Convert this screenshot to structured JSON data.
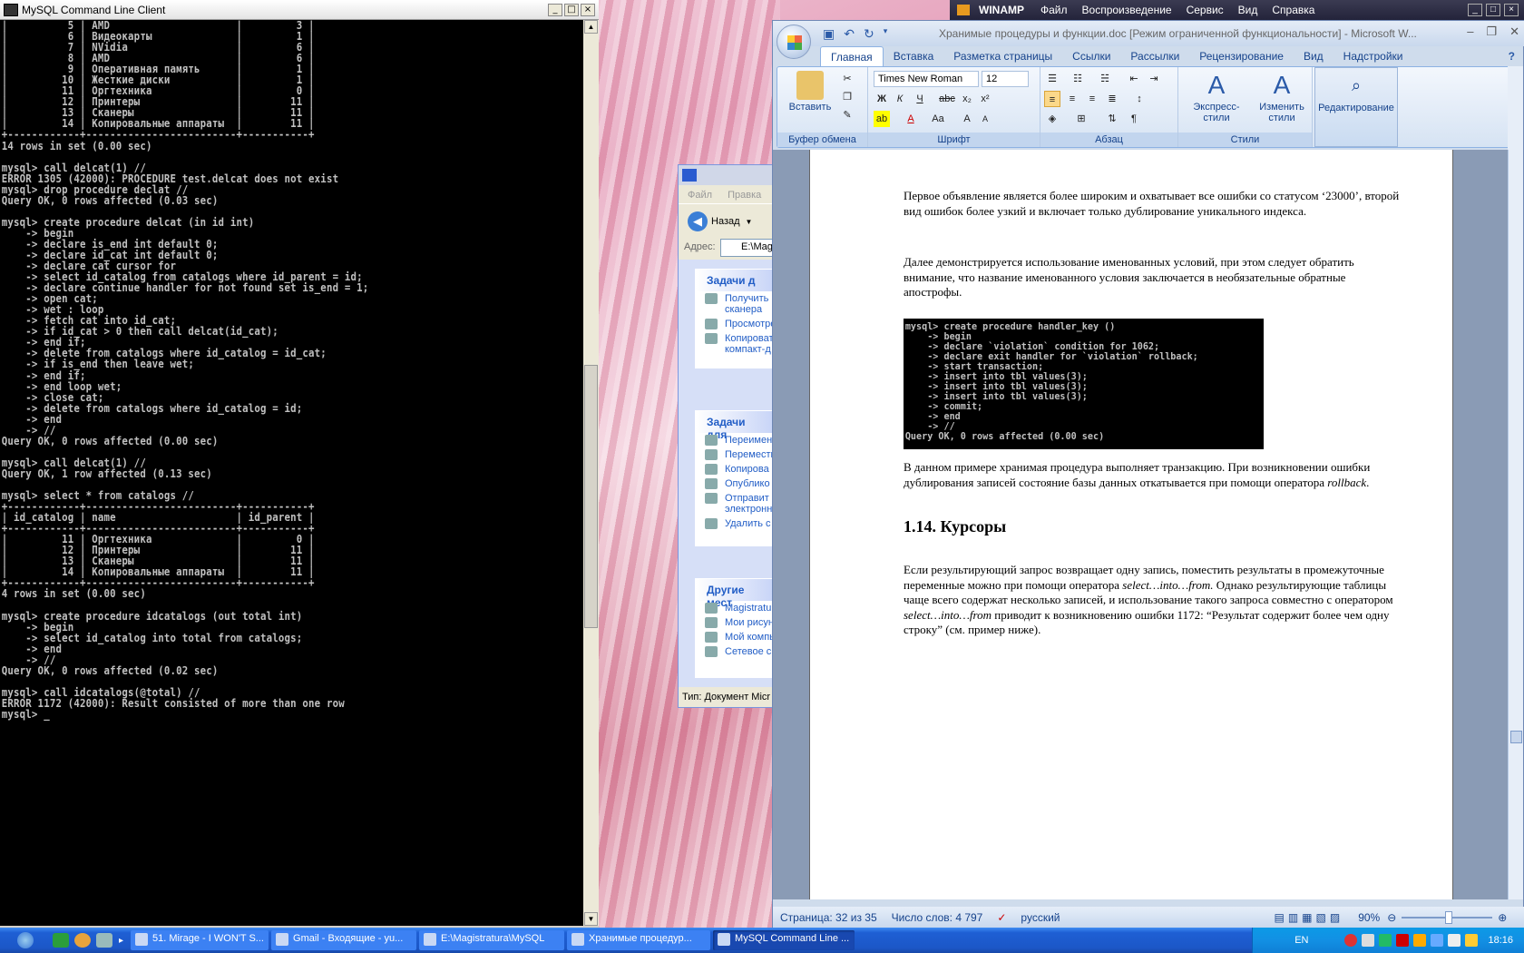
{
  "console": {
    "title": "MySQL Command Line Client",
    "text": "|          5 | AMD                     |         3 |\n|          6 | Видеокарты              |         1 |\n|          7 | NVidia                  |         6 |\n|          8 | AMD                     |         6 |\n|          9 | Оперативная память      |         1 |\n|         10 | Жесткие диски           |         1 |\n|         11 | Оргтехника              |         0 |\n|         12 | Принтеры                |        11 |\n|         13 | Сканеры                 |        11 |\n|         14 | Копировальные аппараты  |        11 |\n+------------+-------------------------+-----------+\n14 rows in set (0.00 sec)\n\nmysql> call delcat(1) //\nERROR 1305 (42000): PROCEDURE test.delcat does not exist\nmysql> drop procedure declat //\nQuery OK, 0 rows affected (0.03 sec)\n\nmysql> create procedure delcat (in id int)\n    -> begin\n    -> declare is_end int default 0;\n    -> declare id_cat int default 0;\n    -> declare cat cursor for\n    -> select id_catalog from catalogs where id_parent = id;\n    -> declare continue handler for not found set is_end = 1;\n    -> open cat;\n    -> wet : loop\n    -> fetch cat into id_cat;\n    -> if id_cat > 0 then call delcat(id_cat);\n    -> end if;\n    -> delete from catalogs where id_catalog = id_cat;\n    -> if is_end then leave wet;\n    -> end if;\n    -> end loop wet;\n    -> close cat;\n    -> delete from catalogs where id_catalog = id;\n    -> end\n    -> //\nQuery OK, 0 rows affected (0.00 sec)\n\nmysql> call delcat(1) //\nQuery OK, 1 row affected (0.13 sec)\n\nmysql> select * from catalogs //\n+------------+-------------------------+-----------+\n| id_catalog | name                    | id_parent |\n+------------+-------------------------+-----------+\n|         11 | Оргтехника              |         0 |\n|         12 | Принтеры                |        11 |\n|         13 | Сканеры                 |        11 |\n|         14 | Копировальные аппараты  |        11 |\n+------------+-------------------------+-----------+\n4 rows in set (0.00 sec)\n\nmysql> create procedure idcatalogs (out total int)\n    -> begin\n    -> select id_catalog into total from catalogs;\n    -> end\n    -> //\nQuery OK, 0 rows affected (0.02 sec)\n\nmysql> call idcatalogs(@total) //\nERROR 1172 (42000): Result consisted of more than one row\nmysql> _"
  },
  "explorer": {
    "menu": "Файл Правка",
    "back": "Назад",
    "address_label": "Адрес:",
    "address": "E:\\Magi",
    "panel1_title": "Задачи д",
    "panel1_items": [
      "Получить сканера",
      "Просмотре",
      "Копироват компакт-д"
    ],
    "panel2_title": "Задачи для",
    "panel2_items": [
      "Переимен",
      "Перемести",
      "Копирова",
      "Опублико",
      "Отправит электронн",
      "Удалить с"
    ],
    "panel3_title": "Другие мест",
    "panel3_items": [
      "Magistratu",
      "Мои рисун",
      "Мой компь",
      "Сетевое с"
    ],
    "status": "Тип: Документ Micr"
  },
  "winamp": {
    "name": "WINAMP",
    "menu": [
      "Файл",
      "Воспроизведение",
      "Сервис",
      "Вид",
      "Справка"
    ]
  },
  "word": {
    "title": "Хранимые процедуры и функции.doc [Режим ограниченной функциональности] - Microsoft W...",
    "tabs": [
      "Главная",
      "Вставка",
      "Разметка страницы",
      "Ссылки",
      "Рассылки",
      "Рецензирование",
      "Вид",
      "Надстройки"
    ],
    "ribbon": {
      "paste": "Вставить",
      "clipboard": "Буфер обмена",
      "font_name": "Times New Roman",
      "font_size": "12",
      "font": "Шрифт",
      "paragraph": "Абзац",
      "styles": "Стили",
      "express_styles": "Экспресс-стили",
      "change_styles": "Изменить стили",
      "editing": "Редактирование"
    },
    "doc": {
      "p1": "Первое объявление является более широким и охватывает все ошибки со статусом ‘23000’, второй вид ошибок более узкий и включает только дублирование уникального индекса.",
      "p2": "Далее демонстрируется использование именованных условий, при этом следует обратить внимание, что название именованного условия заключается в необязательные обратные апострофы.",
      "code": "mysql> create procedure handler_key ()\n    -> begin\n    -> declare `violation` condition for 1062;\n    -> declare exit handler for `violation` rollback;\n    -> start transaction;\n    -> insert into tbl values(3);\n    -> insert into tbl values(3);\n    -> insert into tbl values(3);\n    -> commit;\n    -> end\n    -> //\nQuery OK, 0 rows affected (0.00 sec)",
      "p3a": "В данном примере хранимая процедура выполняет транзакцию. При возникновении ошибки дублирования записей состояние базы данных откатывается при помощи оператора ",
      "p3b": "rollback",
      "p3c": ".",
      "heading": "1.14. Курсоры",
      "p4a": "Если результирующий запрос возвращает одну запись, поместить результаты в промежуточные переменные можно при помощи оператора ",
      "p4b": "select…into…from.",
      "p4c": "  Однако результирующие таблицы чаще всего содержат несколько записей, и использование такого запроса совместно с оператором ",
      "p4d": "select…into…from",
      "p4e": "  приводит к возникновению ошибки 1172: “Результат содержит более чем одну строку” (см. пример ниже)."
    },
    "status": {
      "page": "Страница: 32 из 35",
      "words": "Число слов: 4 797",
      "lang": "русский",
      "zoom": "90%"
    }
  },
  "taskbar": {
    "tasks": [
      "51. Mirage - I WON'T S...",
      "Gmail - Входящие - yu...",
      "E:\\Magistratura\\MySQL",
      "Хранимые процедур...",
      "MySQL Command Line ..."
    ],
    "active": 4,
    "lang": "EN",
    "clock": "18:16"
  }
}
